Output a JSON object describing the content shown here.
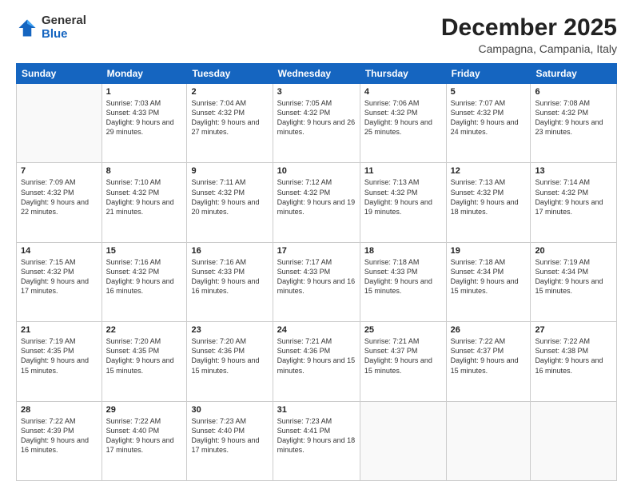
{
  "header": {
    "logo_general": "General",
    "logo_blue": "Blue",
    "month_title": "December 2025",
    "location": "Campagna, Campania, Italy"
  },
  "weekdays": [
    "Sunday",
    "Monday",
    "Tuesday",
    "Wednesday",
    "Thursday",
    "Friday",
    "Saturday"
  ],
  "weeks": [
    [
      {
        "day": "",
        "info": ""
      },
      {
        "day": "1",
        "info": "Sunrise: 7:03 AM\nSunset: 4:33 PM\nDaylight: 9 hours\nand 29 minutes."
      },
      {
        "day": "2",
        "info": "Sunrise: 7:04 AM\nSunset: 4:32 PM\nDaylight: 9 hours\nand 27 minutes."
      },
      {
        "day": "3",
        "info": "Sunrise: 7:05 AM\nSunset: 4:32 PM\nDaylight: 9 hours\nand 26 minutes."
      },
      {
        "day": "4",
        "info": "Sunrise: 7:06 AM\nSunset: 4:32 PM\nDaylight: 9 hours\nand 25 minutes."
      },
      {
        "day": "5",
        "info": "Sunrise: 7:07 AM\nSunset: 4:32 PM\nDaylight: 9 hours\nand 24 minutes."
      },
      {
        "day": "6",
        "info": "Sunrise: 7:08 AM\nSunset: 4:32 PM\nDaylight: 9 hours\nand 23 minutes."
      }
    ],
    [
      {
        "day": "7",
        "info": "Sunrise: 7:09 AM\nSunset: 4:32 PM\nDaylight: 9 hours\nand 22 minutes."
      },
      {
        "day": "8",
        "info": "Sunrise: 7:10 AM\nSunset: 4:32 PM\nDaylight: 9 hours\nand 21 minutes."
      },
      {
        "day": "9",
        "info": "Sunrise: 7:11 AM\nSunset: 4:32 PM\nDaylight: 9 hours\nand 20 minutes."
      },
      {
        "day": "10",
        "info": "Sunrise: 7:12 AM\nSunset: 4:32 PM\nDaylight: 9 hours\nand 19 minutes."
      },
      {
        "day": "11",
        "info": "Sunrise: 7:13 AM\nSunset: 4:32 PM\nDaylight: 9 hours\nand 19 minutes."
      },
      {
        "day": "12",
        "info": "Sunrise: 7:13 AM\nSunset: 4:32 PM\nDaylight: 9 hours\nand 18 minutes."
      },
      {
        "day": "13",
        "info": "Sunrise: 7:14 AM\nSunset: 4:32 PM\nDaylight: 9 hours\nand 17 minutes."
      }
    ],
    [
      {
        "day": "14",
        "info": "Sunrise: 7:15 AM\nSunset: 4:32 PM\nDaylight: 9 hours\nand 17 minutes."
      },
      {
        "day": "15",
        "info": "Sunrise: 7:16 AM\nSunset: 4:32 PM\nDaylight: 9 hours\nand 16 minutes."
      },
      {
        "day": "16",
        "info": "Sunrise: 7:16 AM\nSunset: 4:33 PM\nDaylight: 9 hours\nand 16 minutes."
      },
      {
        "day": "17",
        "info": "Sunrise: 7:17 AM\nSunset: 4:33 PM\nDaylight: 9 hours\nand 16 minutes."
      },
      {
        "day": "18",
        "info": "Sunrise: 7:18 AM\nSunset: 4:33 PM\nDaylight: 9 hours\nand 15 minutes."
      },
      {
        "day": "19",
        "info": "Sunrise: 7:18 AM\nSunset: 4:34 PM\nDaylight: 9 hours\nand 15 minutes."
      },
      {
        "day": "20",
        "info": "Sunrise: 7:19 AM\nSunset: 4:34 PM\nDaylight: 9 hours\nand 15 minutes."
      }
    ],
    [
      {
        "day": "21",
        "info": "Sunrise: 7:19 AM\nSunset: 4:35 PM\nDaylight: 9 hours\nand 15 minutes."
      },
      {
        "day": "22",
        "info": "Sunrise: 7:20 AM\nSunset: 4:35 PM\nDaylight: 9 hours\nand 15 minutes."
      },
      {
        "day": "23",
        "info": "Sunrise: 7:20 AM\nSunset: 4:36 PM\nDaylight: 9 hours\nand 15 minutes."
      },
      {
        "day": "24",
        "info": "Sunrise: 7:21 AM\nSunset: 4:36 PM\nDaylight: 9 hours\nand 15 minutes."
      },
      {
        "day": "25",
        "info": "Sunrise: 7:21 AM\nSunset: 4:37 PM\nDaylight: 9 hours\nand 15 minutes."
      },
      {
        "day": "26",
        "info": "Sunrise: 7:22 AM\nSunset: 4:37 PM\nDaylight: 9 hours\nand 15 minutes."
      },
      {
        "day": "27",
        "info": "Sunrise: 7:22 AM\nSunset: 4:38 PM\nDaylight: 9 hours\nand 16 minutes."
      }
    ],
    [
      {
        "day": "28",
        "info": "Sunrise: 7:22 AM\nSunset: 4:39 PM\nDaylight: 9 hours\nand 16 minutes."
      },
      {
        "day": "29",
        "info": "Sunrise: 7:22 AM\nSunset: 4:40 PM\nDaylight: 9 hours\nand 17 minutes."
      },
      {
        "day": "30",
        "info": "Sunrise: 7:23 AM\nSunset: 4:40 PM\nDaylight: 9 hours\nand 17 minutes."
      },
      {
        "day": "31",
        "info": "Sunrise: 7:23 AM\nSunset: 4:41 PM\nDaylight: 9 hours\nand 18 minutes."
      },
      {
        "day": "",
        "info": ""
      },
      {
        "day": "",
        "info": ""
      },
      {
        "day": "",
        "info": ""
      }
    ]
  ]
}
